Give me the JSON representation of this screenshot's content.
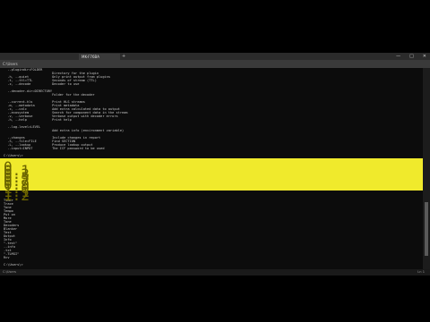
{
  "window": {
    "tab_title": "MK-F76BA",
    "address": "C:\\Users",
    "controls": [
      "—",
      "□",
      "✕"
    ]
  },
  "terminal": {
    "lines_top": [
      "  --plugindir=FOLDER",
      "                         Directory for the plugin",
      "  -h, --quiet            Only print output from plugins",
      "  -t, --ttl=TTL          Seconds of stream (TTL)",
      "  -z, --decode           Decoder to use",
      "",
      "  --decoder-dir=DIRECTORY",
      "                         Folder for the decoder",
      "",
      "  --current-hls          Print HLS streams",
      "  -m, --metadata         Print metadata",
      "  -c, --calc             Add extra calculated data to output",
      "  --ecosystem            Search for component data in the stream",
      "  -v, --verbose          Verbose output with decoder errors",
      "  -h, --help             Print help",
      "",
      "  --log-level=LEVEL",
      "                         Add extra info (environment variable)",
      "",
      "  --changes              Include changes in report",
      "  -S, --file=FILE        Find SECTION",
      "  -L, --lookup           Produce lookup output",
      "  --input=INPUT          The ICF password to be used",
      "",
      "C:\\Users\\>",
      "",
      "C:\\Users\\> "
    ],
    "lines_highlight": [
      "0",
      "0.1",
      "0.3",
      "0.5",
      "0.7",
      "0.9",
      "1.0",
      "1.1",
      "1.2"
    ],
    "lines_bottom": [
      "Timer",
      "Trace",
      "Tone",
      "Tempo",
      "Put on",
      "More",
      "Tone",
      "Decoders",
      "Blanker",
      "Test",
      "Output",
      "Info",
      "\"-test\"",
      "--info",
      ".txt",
      "\"-TLMGI\"",
      "Rcv",
      "",
      "C:\\Users\\>",
      "",
      "C:\\Users\\> "
    ]
  },
  "status": {
    "left": "C:\\Users",
    "right": "Ln 1"
  }
}
